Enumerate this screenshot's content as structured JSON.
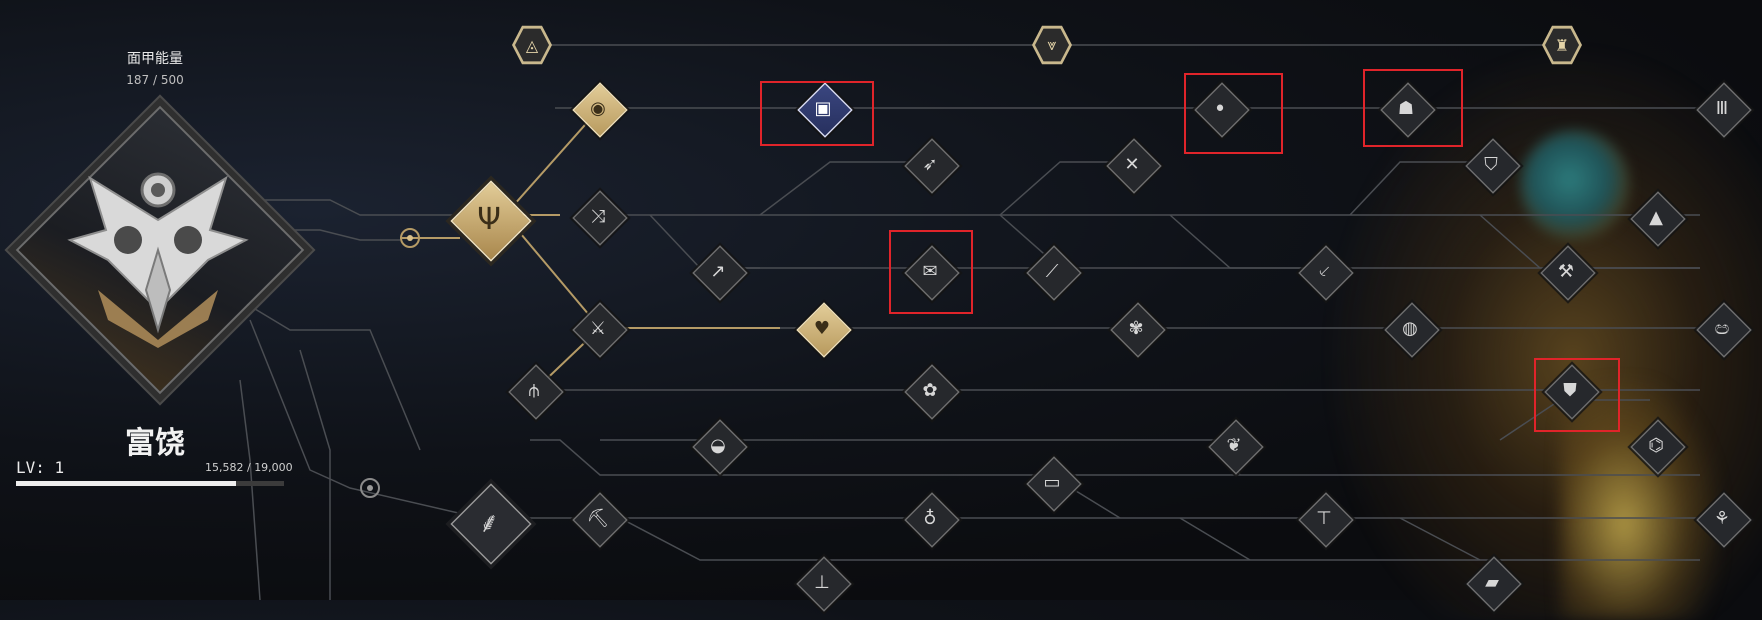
{
  "panel": {
    "energy_label": "面甲能量",
    "energy_value": "187 / 500",
    "title": "富饶",
    "level_label": "LV: 1",
    "xp_text": "15,582 / 19,000",
    "xp_progress": 0.82
  },
  "colors": {
    "highlight_box": "#e0242a",
    "gold_node": "#d8c08a",
    "blue_node": "#3a4680",
    "line": "#5a5a5a"
  },
  "tree": {
    "top_hexes": [
      {
        "icon": "triangle-rune-icon"
      },
      {
        "icon": "leaf-down-icon"
      },
      {
        "icon": "helmet-crest-icon"
      }
    ],
    "nodes": [
      {
        "icon": "eye-icon",
        "state": "unlocked"
      },
      {
        "icon": "split-arrows-icon",
        "state": "unlocked"
      },
      {
        "icon": "crossed-blades-icon",
        "state": "unlocked"
      },
      {
        "icon": "triple-spears-icon",
        "state": "unlocked"
      },
      {
        "icon": "heart-pulse-icon",
        "state": "unlocked"
      },
      {
        "icon": "trident-icon",
        "state": "key"
      },
      {
        "icon": "feather-icon",
        "state": "key"
      },
      {
        "icon": "armor-icon",
        "state": "selected"
      },
      {
        "icon": "scroll-icon",
        "state": "locked"
      },
      {
        "icon": "twin-figures-icon",
        "state": "locked"
      },
      {
        "icon": "hooded-figure-icon",
        "state": "locked"
      },
      {
        "icon": "mask-shield-icon",
        "state": "locked"
      }
    ]
  }
}
